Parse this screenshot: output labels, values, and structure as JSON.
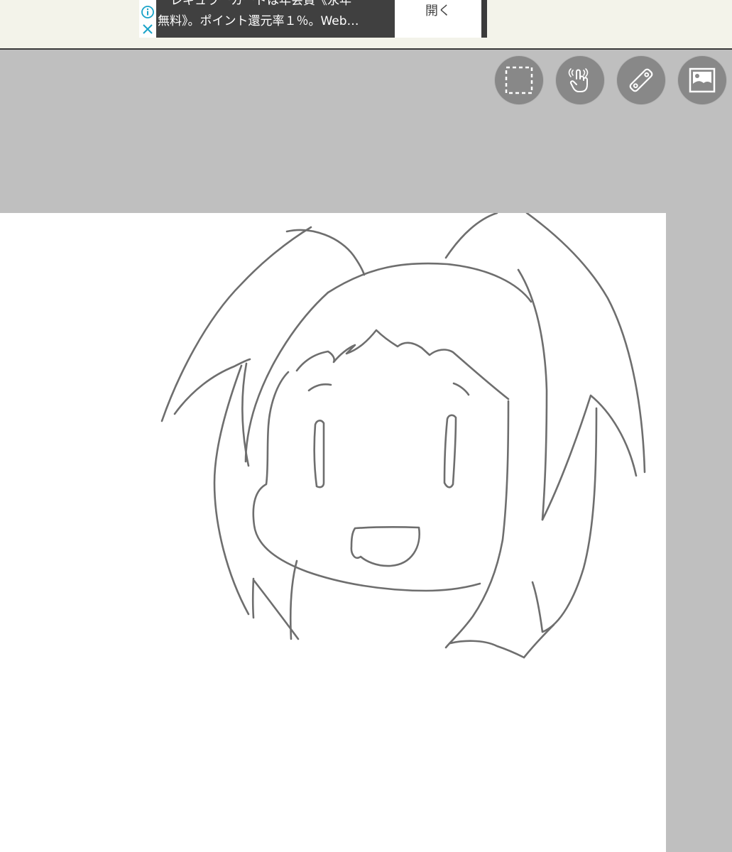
{
  "ad": {
    "line1": "レギュラーカードは年会費《永年",
    "line2": "無料》。ポイント還元率１％。Web…",
    "open_label": "開く",
    "info_icon": "info-icon",
    "close_icon": "close-icon",
    "accent_color": "#1aa3c8"
  },
  "toolbar": {
    "tools": [
      {
        "name": "selection-tool",
        "icon": "dashed-square-icon"
      },
      {
        "name": "hand-tool",
        "icon": "pointing-hand-icon"
      },
      {
        "name": "ruler-tool",
        "icon": "ruler-icon"
      },
      {
        "name": "image-tool",
        "icon": "image-icon"
      }
    ],
    "button_color": "#888888"
  },
  "canvas": {
    "background": "#ffffff",
    "stroke_color": "#6e6e6e"
  }
}
